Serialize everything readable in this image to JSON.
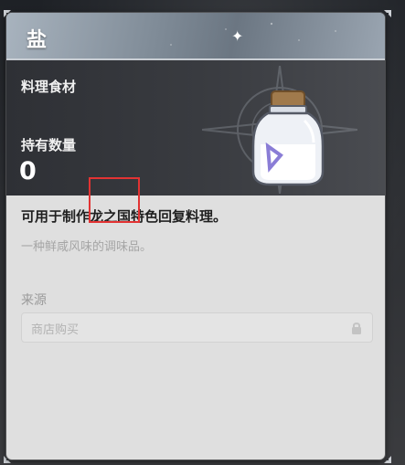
{
  "item": {
    "title": "盐",
    "category": "料理食材",
    "quantity_label": "持有数量",
    "quantity": "0",
    "description": "可用于制作龙之国特色回复料理。",
    "flavor": "一种鲜咸风味的调味品。"
  },
  "source": {
    "label": "来源",
    "entry": "商店购买"
  },
  "icons": {
    "item": "salt-bottle-icon",
    "lock": "lock-icon",
    "decoration": "compass-star-icon"
  },
  "colors": {
    "highlight": "#e23333",
    "card_bg": "#dfdfdf",
    "header_dark": "#2e3035"
  }
}
